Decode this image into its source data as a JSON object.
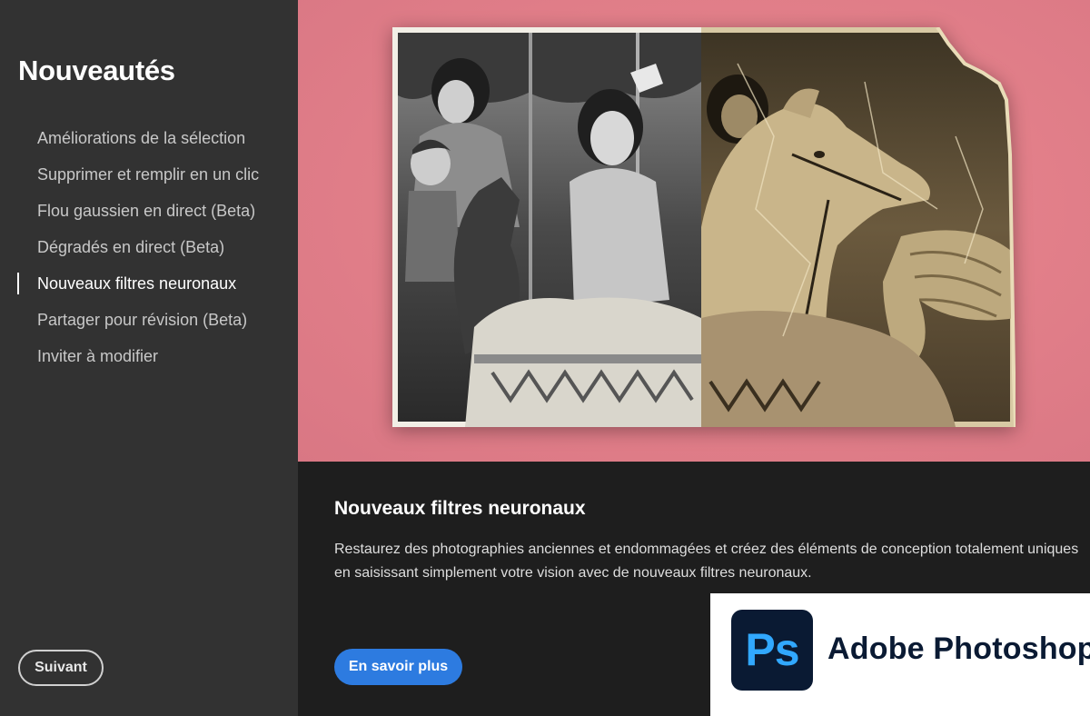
{
  "sidebar": {
    "title": "Nouveautés",
    "items": [
      {
        "label": "Améliorations de la sélection",
        "active": false
      },
      {
        "label": "Supprimer et remplir en un clic",
        "active": false
      },
      {
        "label": "Flou gaussien en direct (Beta)",
        "active": false
      },
      {
        "label": "Dégradés en direct (Beta)",
        "active": false
      },
      {
        "label": "Nouveaux filtres neuronaux",
        "active": true
      },
      {
        "label": "Partager pour révision (Beta)",
        "active": false
      },
      {
        "label": "Inviter à modifier",
        "active": false
      }
    ],
    "next_label": "Suivant"
  },
  "hero": {
    "background_color": "#e3808a"
  },
  "content": {
    "title": "Nouveaux filtres neuronaux",
    "description": "Restaurez des photographies anciennes et endommagées et créez des éléments de conception totalement uniques en saisissant simplement votre vision avec de nouveaux filtres neuronaux.",
    "learn_more_label": "En savoir plus"
  },
  "logo": {
    "icon_text": "Ps",
    "brand_name": "Adobe Photoshop",
    "icon_bg": "#0a1a33",
    "icon_fg": "#31a8ff"
  },
  "colors": {
    "sidebar_bg": "#323232",
    "content_bg": "#1e1e1e",
    "accent_blue": "#2d7be0"
  }
}
